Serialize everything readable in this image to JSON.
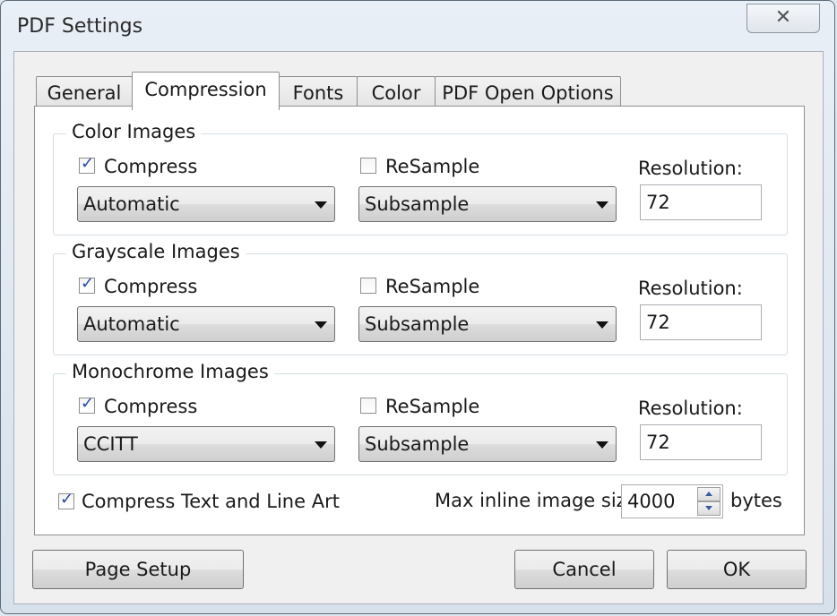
{
  "window": {
    "title": "PDF Settings",
    "close_glyph": "✕"
  },
  "tabs": [
    {
      "label": "General"
    },
    {
      "label": "Compression"
    },
    {
      "label": "Fonts"
    },
    {
      "label": "Color"
    },
    {
      "label": "PDF Open Options"
    }
  ],
  "active_tab": "Compression",
  "groups": [
    {
      "title": "Color Images",
      "compress_label": "Compress",
      "compress_checked": true,
      "resample_label": "ReSample",
      "resample_checked": false,
      "method": "Automatic",
      "resample_method": "Subsample",
      "resolution_label": "Resolution:",
      "resolution": "72"
    },
    {
      "title": "Grayscale Images",
      "compress_label": "Compress",
      "compress_checked": true,
      "resample_label": "ReSample",
      "resample_checked": false,
      "method": "Automatic",
      "resample_method": "Subsample",
      "resolution_label": "Resolution:",
      "resolution": "72"
    },
    {
      "title": "Monochrome Images",
      "compress_label": "Compress",
      "compress_checked": true,
      "resample_label": "ReSample",
      "resample_checked": false,
      "method": "CCITT",
      "resample_method": "Subsample",
      "resolution_label": "Resolution:",
      "resolution": "72"
    }
  ],
  "compress_text": {
    "label": "Compress Text and Line Art",
    "checked": true
  },
  "max_inline": {
    "label": "Max inline image size",
    "value": "4000",
    "unit": "bytes"
  },
  "buttons": {
    "page_setup": "Page Setup",
    "cancel": "Cancel",
    "ok": "OK"
  }
}
